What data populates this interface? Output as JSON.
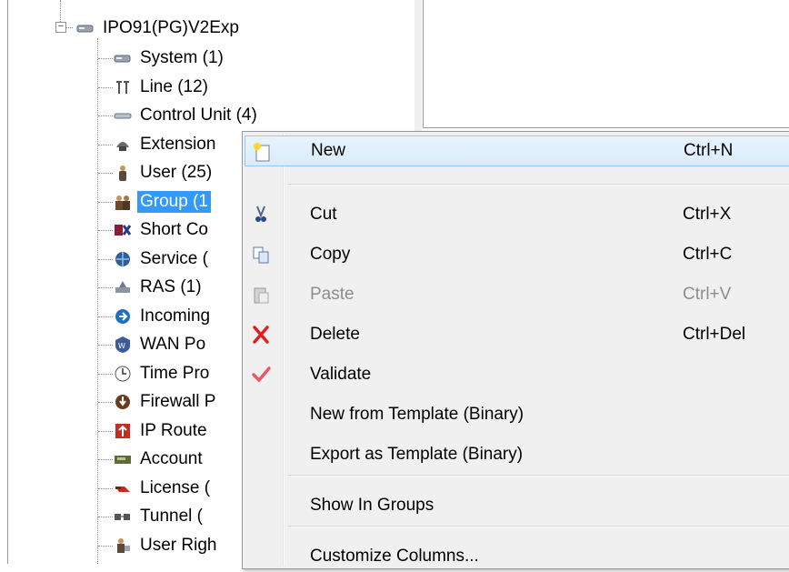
{
  "tree": {
    "root_label": "IPO91(PG)V2Exp",
    "items": [
      {
        "label": "System (1)",
        "icon": "system-icon"
      },
      {
        "label": "Line (12)",
        "icon": "line-icon"
      },
      {
        "label": "Control Unit (4)",
        "icon": "control-unit-icon"
      },
      {
        "label": "Extension",
        "icon": "extension-icon"
      },
      {
        "label": "User (25)",
        "icon": "user-icon"
      },
      {
        "label": "Group (1",
        "icon": "group-icon",
        "selected": true
      },
      {
        "label": "Short Co",
        "icon": "short-code-icon"
      },
      {
        "label": "Service (",
        "icon": "service-icon"
      },
      {
        "label": "RAS (1)",
        "icon": "ras-icon"
      },
      {
        "label": "Incoming",
        "icon": "incoming-icon"
      },
      {
        "label": "WAN Po",
        "icon": "wan-port-icon"
      },
      {
        "label": "Time Pro",
        "icon": "time-profile-icon"
      },
      {
        "label": "Firewall P",
        "icon": "firewall-icon"
      },
      {
        "label": "IP Route",
        "icon": "ip-route-icon"
      },
      {
        "label": "Account",
        "icon": "account-icon"
      },
      {
        "label": "License (",
        "icon": "license-icon"
      },
      {
        "label": "Tunnel (",
        "icon": "tunnel-icon"
      },
      {
        "label": "User Righ",
        "icon": "user-rights-icon"
      }
    ]
  },
  "context_menu": {
    "items": [
      {
        "label": "New",
        "shortcut": "Ctrl+N",
        "icon": "new-icon",
        "highlighted": true
      },
      {
        "label": "Cut",
        "shortcut": "Ctrl+X",
        "icon": "cut-icon"
      },
      {
        "label": "Copy",
        "shortcut": "Ctrl+C",
        "icon": "copy-icon"
      },
      {
        "label": "Paste",
        "shortcut": "Ctrl+V",
        "icon": "paste-icon",
        "disabled": true
      },
      {
        "label": "Delete",
        "shortcut": "Ctrl+Del",
        "icon": "delete-icon"
      },
      {
        "label": "Validate",
        "shortcut": "",
        "icon": "validate-icon"
      },
      {
        "label": "New from Template (Binary)",
        "shortcut": ""
      },
      {
        "label": "Export as Template (Binary)",
        "shortcut": ""
      },
      {
        "label": "Show In Groups",
        "shortcut": ""
      },
      {
        "label": "Customize Columns...",
        "shortcut": ""
      }
    ]
  },
  "colors": {
    "selection": "#3399ff",
    "menu_bg": "#f0f0f0",
    "highlight_border": "#90c8f6",
    "delete_red": "#e02020"
  }
}
